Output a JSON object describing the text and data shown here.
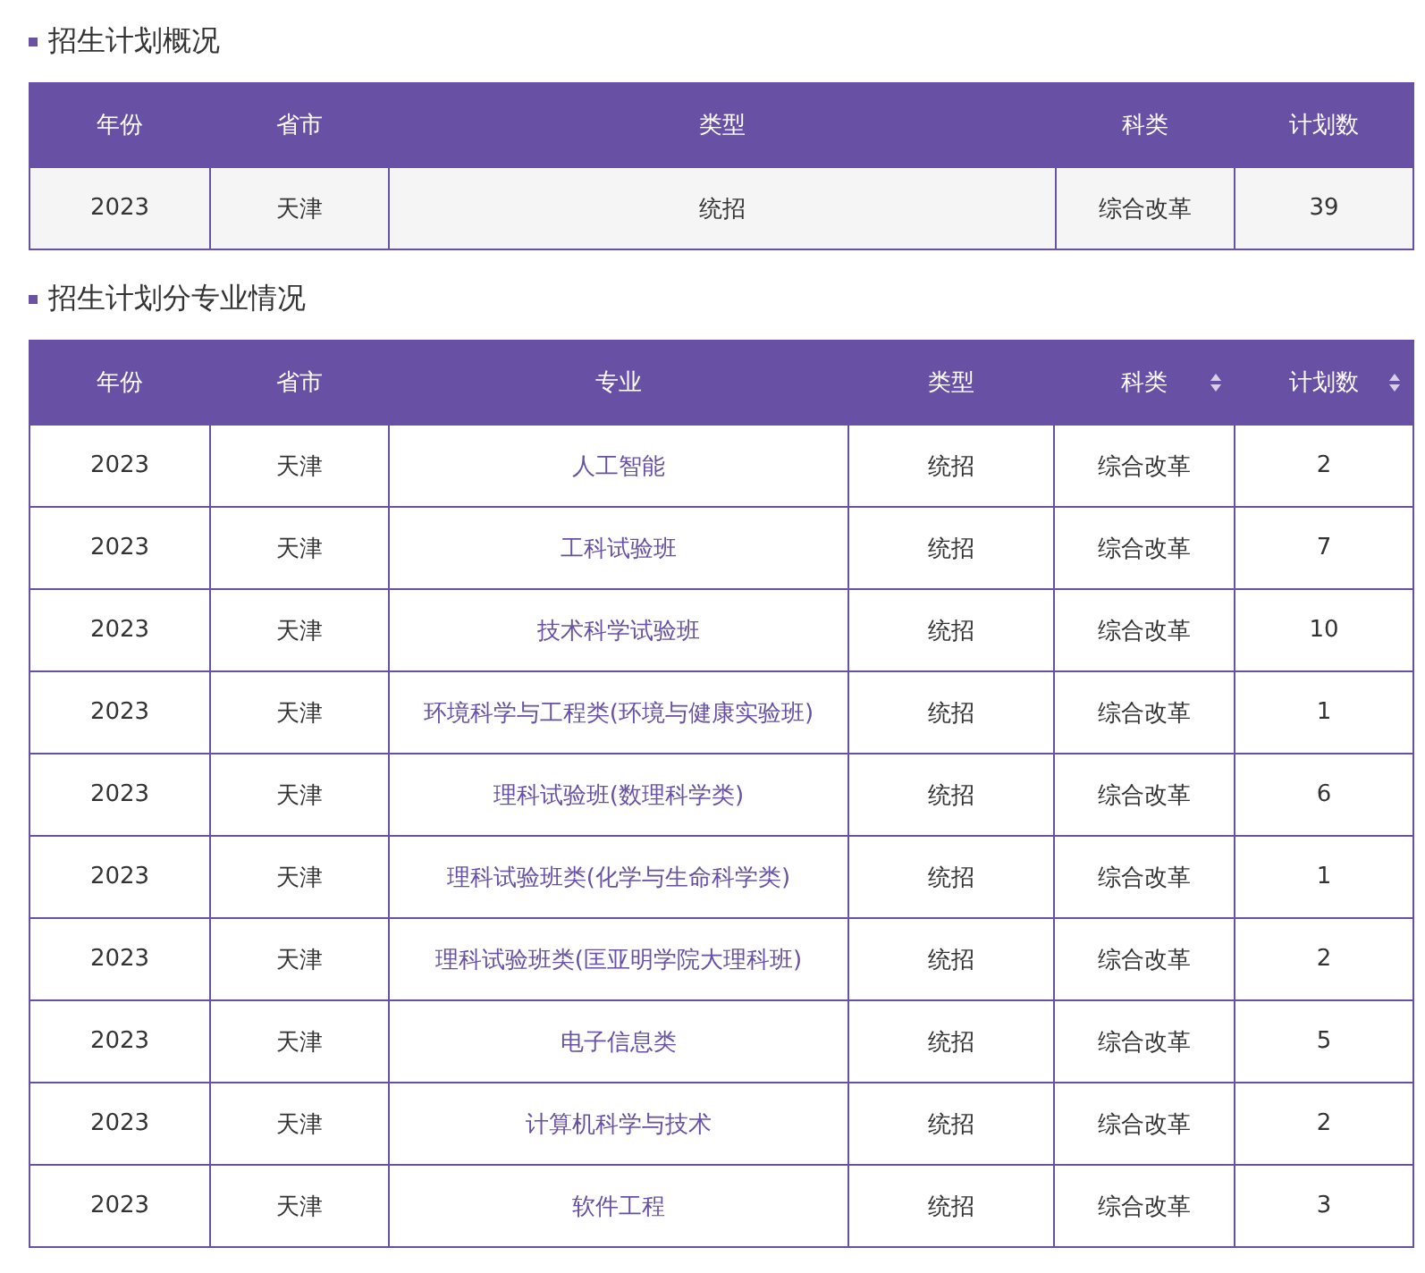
{
  "sections": [
    {
      "title": "招生计划概况",
      "columns": [
        {
          "label": "年份",
          "sortable": false,
          "kind": "text"
        },
        {
          "label": "省市",
          "sortable": false,
          "kind": "text"
        },
        {
          "label": "类型",
          "sortable": false,
          "kind": "text"
        },
        {
          "label": "科类",
          "sortable": false,
          "kind": "text"
        },
        {
          "label": "计划数",
          "sortable": false,
          "kind": "text"
        }
      ],
      "rows": [
        [
          "2023",
          "天津",
          "统招",
          "综合改革",
          "39"
        ]
      ]
    },
    {
      "title": "招生计划分专业情况",
      "columns": [
        {
          "label": "年份",
          "sortable": false,
          "kind": "text"
        },
        {
          "label": "省市",
          "sortable": false,
          "kind": "text"
        },
        {
          "label": "专业",
          "sortable": false,
          "kind": "link"
        },
        {
          "label": "类型",
          "sortable": false,
          "kind": "text"
        },
        {
          "label": "科类",
          "sortable": true,
          "kind": "text"
        },
        {
          "label": "计划数",
          "sortable": true,
          "kind": "text"
        }
      ],
      "rows": [
        [
          "2023",
          "天津",
          "人工智能",
          "统招",
          "综合改革",
          "2"
        ],
        [
          "2023",
          "天津",
          "工科试验班",
          "统招",
          "综合改革",
          "7"
        ],
        [
          "2023",
          "天津",
          "技术科学试验班",
          "统招",
          "综合改革",
          "10"
        ],
        [
          "2023",
          "天津",
          "环境科学与工程类(环境与健康实验班)",
          "统招",
          "综合改革",
          "1"
        ],
        [
          "2023",
          "天津",
          "理科试验班(数理科学类)",
          "统招",
          "综合改革",
          "6"
        ],
        [
          "2023",
          "天津",
          "理科试验班类(化学与生命科学类)",
          "统招",
          "综合改革",
          "1"
        ],
        [
          "2023",
          "天津",
          "理科试验班类(匡亚明学院大理科班)",
          "统招",
          "综合改革",
          "2"
        ],
        [
          "2023",
          "天津",
          "电子信息类",
          "统招",
          "综合改革",
          "5"
        ],
        [
          "2023",
          "天津",
          "计算机科学与技术",
          "统招",
          "综合改革",
          "2"
        ],
        [
          "2023",
          "天津",
          "软件工程",
          "统招",
          "综合改革",
          "3"
        ]
      ]
    }
  ]
}
